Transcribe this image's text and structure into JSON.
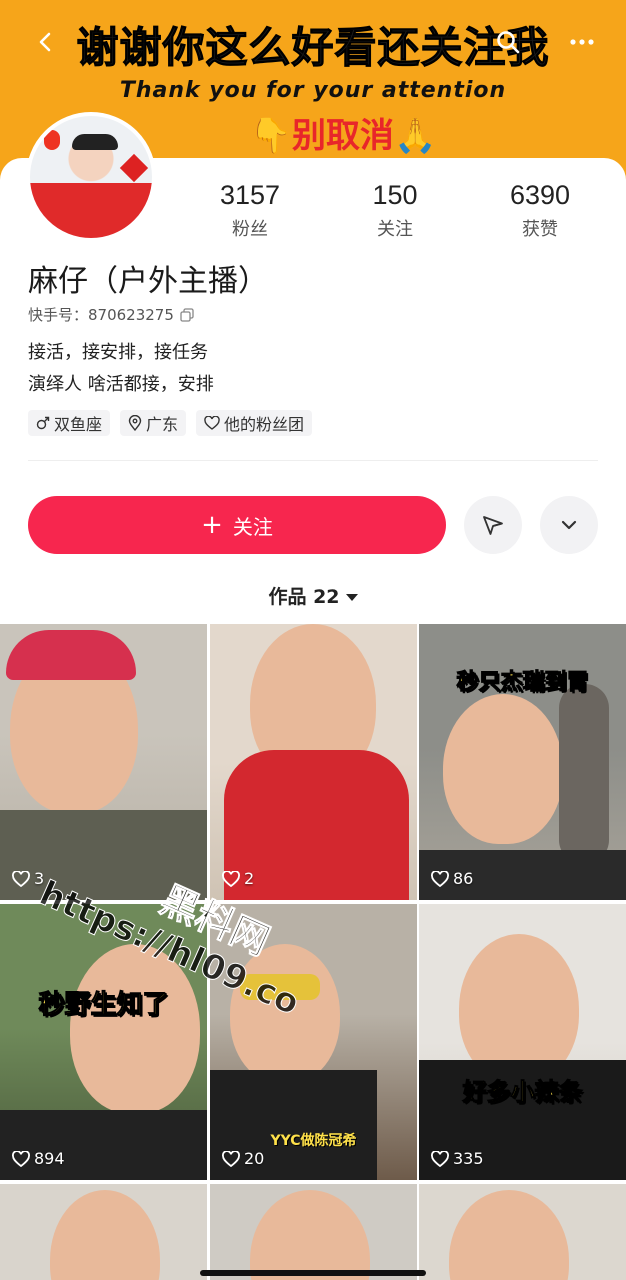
{
  "banner": {
    "line1": "谢谢你这么好看还关注我",
    "line2": "Thank you for your attention",
    "line3": "👇别取消🙏"
  },
  "icons": {
    "back": "chevron-left-icon",
    "search": "search-icon",
    "more": "more-dots-icon"
  },
  "stats": [
    {
      "value": "3157",
      "label": "粉丝"
    },
    {
      "value": "150",
      "label": "关注"
    },
    {
      "value": "6390",
      "label": "获赞"
    }
  ],
  "profile": {
    "name": "麻仔（户外主播）",
    "kuaishou_id": "快手号：870623275",
    "bio_line1": "接活，接安排，接任务",
    "bio_line2": "演绎人 啥活都接，安排"
  },
  "tags": [
    {
      "label": "双鱼座",
      "icon": "male-icon"
    },
    {
      "label": "广东",
      "icon": "location-pin-icon"
    },
    {
      "label": "他的粉丝团",
      "icon": "fan-club-heart-icon"
    }
  ],
  "actions": {
    "follow_label": "关注",
    "follow_prefix": "+"
  },
  "works": {
    "label": "作品 22"
  },
  "videos": [
    {
      "likes": "3",
      "caption": ""
    },
    {
      "likes": "2",
      "caption": ""
    },
    {
      "likes": "86",
      "caption": "秒只杰瑞到胃"
    },
    {
      "likes": "894",
      "caption": "秒野生知了"
    },
    {
      "likes": "20",
      "caption": "YYC做陈冠希"
    },
    {
      "likes": "335",
      "caption": "好多小辣条"
    },
    {
      "likes": "",
      "caption": ""
    },
    {
      "likes": "",
      "caption": ""
    },
    {
      "likes": "",
      "caption": ""
    }
  ],
  "watermark": {
    "line1": "黑料网",
    "line2": "https://hl09.co"
  },
  "colors": {
    "banner": "#f6a51a",
    "follow_button": "#f7264e",
    "banner_red_text": "#e8262a"
  }
}
